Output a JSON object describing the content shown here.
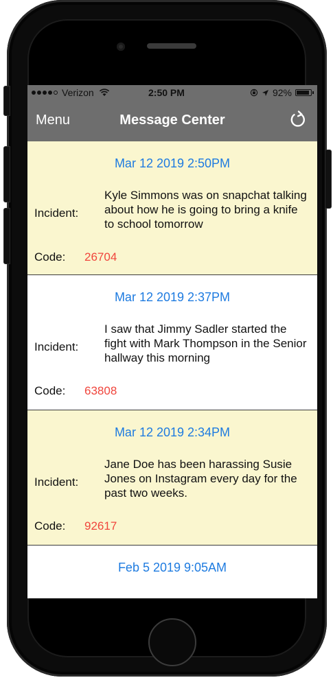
{
  "status_bar": {
    "carrier": "Verizon",
    "time": "2:50 PM",
    "battery": "92%",
    "battery_level": 0.92,
    "icons": [
      "signal-dots",
      "wifi-icon",
      "orientation-lock-icon",
      "location-icon",
      "battery-icon"
    ]
  },
  "nav": {
    "menu_label": "Menu",
    "title": "Message Center",
    "refresh_icon": "refresh-icon",
    "bar_color": "#6e6e6e"
  },
  "messages": [
    {
      "date": "Mar 12 2019  2:50PM",
      "incident_label": "Incident:",
      "text": "Kyle Simmons was on snapchat talking about how he is going to bring a knife to school tomorrow",
      "code_label": "Code:",
      "code": "26704",
      "background": "#faf6cf"
    },
    {
      "date": "Mar 12 2019  2:37PM",
      "incident_label": "Incident:",
      "text": "I saw that Jimmy Sadler started the fight with Mark Thompson in the Senior hallway this morning",
      "code_label": "Code:",
      "code": "63808",
      "background": "#ffffff"
    },
    {
      "date": "Mar 12 2019  2:34PM",
      "incident_label": "Incident:",
      "text": "Jane Doe has been harassing Susie Jones on Instagram every day for the past two weeks.",
      "code_label": "Code:",
      "code": "92617",
      "background": "#faf6cf"
    },
    {
      "date": "Feb 5 2019  9:05AM",
      "background": "#ffffff"
    }
  ],
  "colors": {
    "date": "#1e7be0",
    "code": "#f0453c",
    "highlight_row": "#faf6cf"
  }
}
